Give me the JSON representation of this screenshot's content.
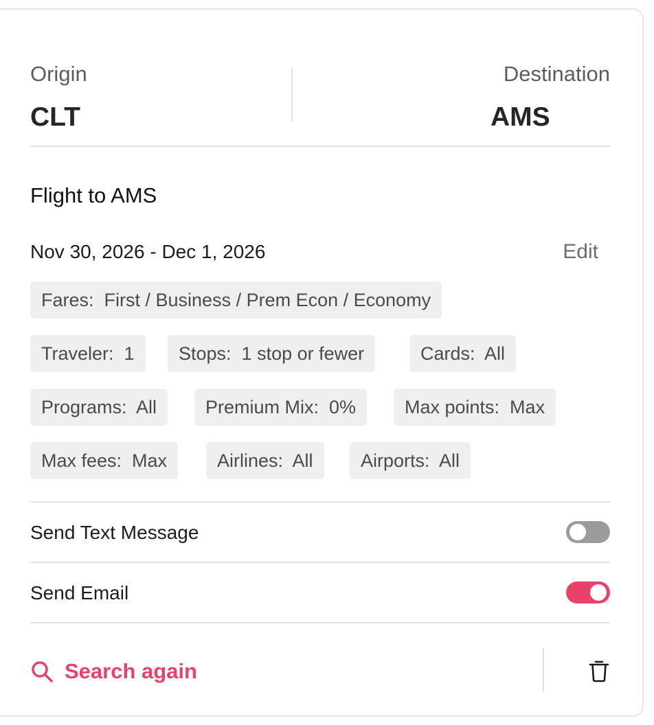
{
  "route": {
    "origin_label": "Origin",
    "origin_code": "CLT",
    "destination_label": "Destination",
    "destination_code": "AMS"
  },
  "flight": {
    "title": "Flight to AMS",
    "dates": "Nov 30, 2026 - Dec 1, 2026",
    "edit_label": "Edit"
  },
  "filters": [
    "Fares:  First / Business / Prem Econ / Economy",
    "Traveler:  1",
    "Stops:  1 stop or fewer",
    "Cards:  All",
    "Programs:  All",
    "Premium Mix:  0%",
    "Max points:  Max",
    "Max fees:  Max",
    "Airlines:  All",
    "Airports:  All"
  ],
  "notifications": {
    "text_label": "Send Text Message",
    "text_enabled": false,
    "email_label": "Send Email",
    "email_enabled": true
  },
  "footer": {
    "search_again_label": "Search again",
    "search_icon": "search-icon",
    "delete_icon": "trash-icon"
  },
  "colors": {
    "accent": "#e8416a",
    "chip_bg": "#efefef",
    "toggle_off": "#9b9b9b"
  }
}
